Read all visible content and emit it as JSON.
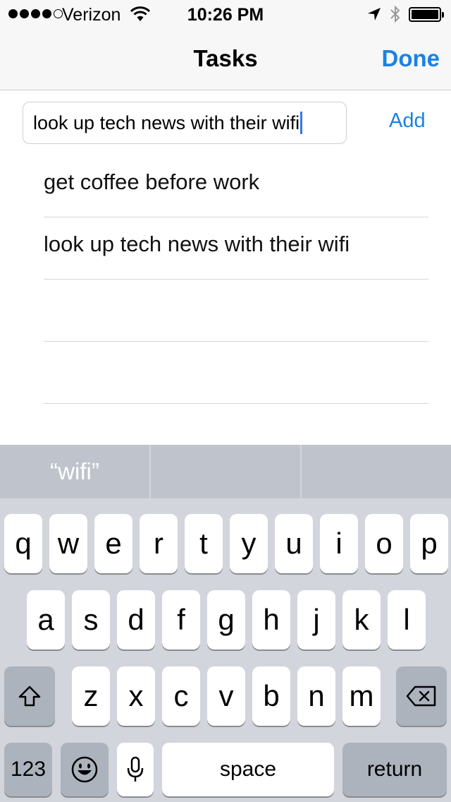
{
  "status_bar": {
    "carrier": "Verizon",
    "time": "10:26 PM",
    "signal_bars": 4,
    "signal_total": 5,
    "battery_level": 1.0
  },
  "nav": {
    "title": "Tasks",
    "done_label": "Done"
  },
  "input": {
    "value": "look up tech news with their wifi"
  },
  "add_label": "Add",
  "tasks": [
    "get coffee before work",
    "look up tech news with their wifi",
    "",
    ""
  ],
  "keyboard": {
    "suggestions": [
      "“wifi”",
      "",
      ""
    ],
    "rows": [
      [
        "q",
        "w",
        "e",
        "r",
        "t",
        "y",
        "u",
        "i",
        "o",
        "p"
      ],
      [
        "a",
        "s",
        "d",
        "f",
        "g",
        "h",
        "j",
        "k",
        "l"
      ],
      [
        "z",
        "x",
        "c",
        "v",
        "b",
        "n",
        "m"
      ]
    ],
    "numbers_label": "123",
    "space_label": "space",
    "return_label": "return"
  },
  "colors": {
    "accent": "#1a82e3",
    "keyboard_bg": "#d2d5db",
    "key_dark": "#acb3bd",
    "suggest_bg": "#bfc4cc"
  },
  "icons": [
    "wifi-icon",
    "location-arrow-icon",
    "bluetooth-icon",
    "battery-icon",
    "shift-icon",
    "backspace-icon",
    "emoji-icon",
    "microphone-icon"
  ]
}
